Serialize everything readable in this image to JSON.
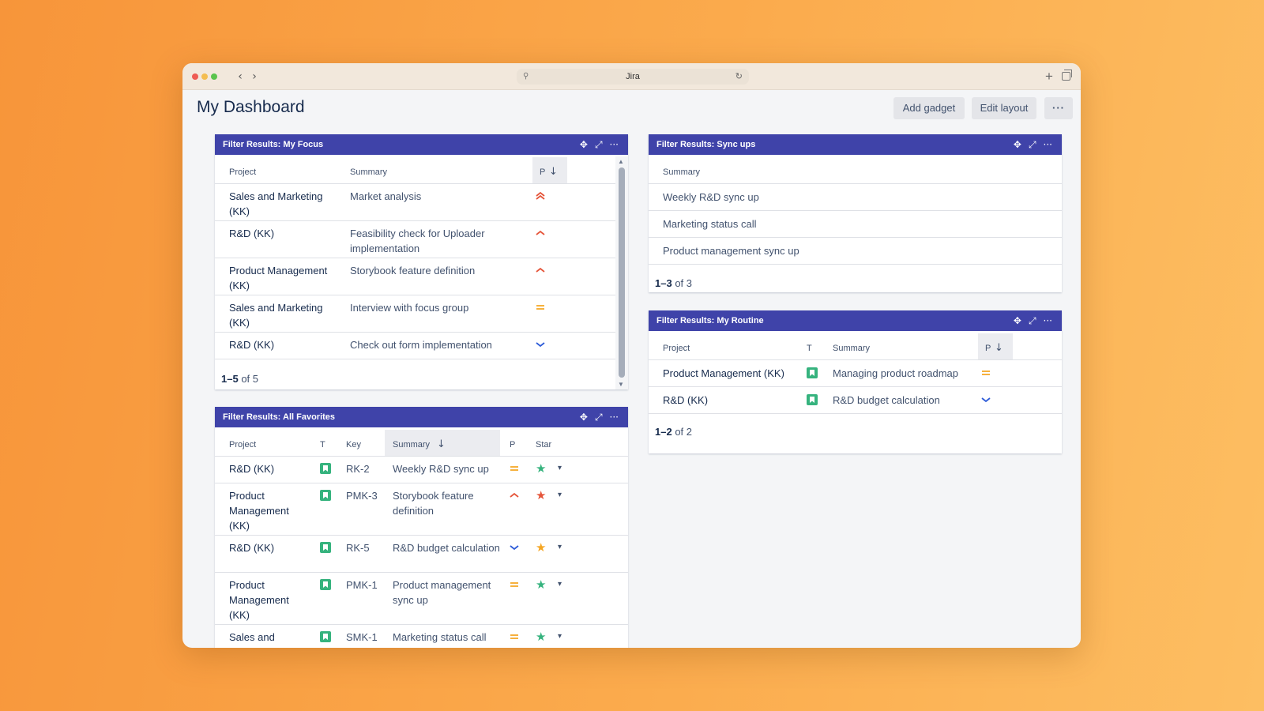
{
  "browser": {
    "url_text": "Jira",
    "back_icon": "chevron-left-icon",
    "forward_icon": "chevron-right-icon"
  },
  "header": {
    "title": "My Dashboard",
    "add_gadget": "Add gadget",
    "edit_layout": "Edit layout",
    "more": "···"
  },
  "focus": {
    "title": "Filter Results: My Focus",
    "columns": {
      "project": "Project",
      "summary": "Summary",
      "p": "P"
    },
    "rows": [
      {
        "project": "Sales and Marketing (KK)",
        "summary": "Market analysis",
        "priority": "highest"
      },
      {
        "project": "R&D (KK)",
        "summary": "Feasibility check for Uploader implementation",
        "priority": "high"
      },
      {
        "project": "Product Management (KK)",
        "summary": "Storybook feature definition",
        "priority": "high"
      },
      {
        "project": "Sales and Marketing (KK)",
        "summary": "Interview with focus group",
        "priority": "medium"
      },
      {
        "project": "R&D (KK)",
        "summary": "Check out form implementation",
        "priority": "low"
      }
    ],
    "count_range": "1–5",
    "count_of": "of",
    "count_total": "5"
  },
  "favorites": {
    "title": "Filter Results: All Favorites",
    "columns": {
      "project": "Project",
      "t": "T",
      "key": "Key",
      "summary": "Summary",
      "p": "P",
      "star": "Star"
    },
    "rows": [
      {
        "project": "R&D (KK)",
        "key": "RK-2",
        "summary": "Weekly R&D sync up",
        "priority": "medium",
        "star_color": "#36b37e"
      },
      {
        "project": "Product Management (KK)",
        "key": "PMK-3",
        "summary": "Storybook feature definition",
        "priority": "high",
        "star_color": "#e5553a"
      },
      {
        "project": "R&D (KK)",
        "key": "RK-5",
        "summary": "R&D budget calculation",
        "priority": "low",
        "star_color": "#f5a623"
      },
      {
        "project": "Product Management (KK)",
        "key": "PMK-1",
        "summary": "Product management sync up",
        "priority": "medium",
        "star_color": "#36b37e"
      },
      {
        "project": "Sales and",
        "key": "SMK-1",
        "summary": "Marketing status call",
        "priority": "medium",
        "star_color": "#36b37e"
      }
    ]
  },
  "syncups": {
    "title": "Filter Results: Sync ups",
    "columns": {
      "summary": "Summary"
    },
    "rows": [
      {
        "summary": "Weekly R&D sync up"
      },
      {
        "summary": "Marketing status call"
      },
      {
        "summary": "Product management sync up"
      }
    ],
    "count_range": "1–3",
    "count_of": "of",
    "count_total": "3"
  },
  "routine": {
    "title": "Filter Results: My Routine",
    "columns": {
      "project": "Project",
      "t": "T",
      "summary": "Summary",
      "p": "P"
    },
    "rows": [
      {
        "project": "Product Management (KK)",
        "summary": "Managing product roadmap",
        "priority": "medium"
      },
      {
        "project": "R&D (KK)",
        "summary": "R&D budget calculation",
        "priority": "low"
      }
    ],
    "count_range": "1–2",
    "count_of": "of",
    "count_total": "2"
  },
  "colors": {
    "gadget_header": "#3f43a9",
    "priority_high": "#e5553a",
    "priority_medium": "#f5a623",
    "priority_low": "#2d5bd8",
    "type_story": "#36b37e"
  }
}
